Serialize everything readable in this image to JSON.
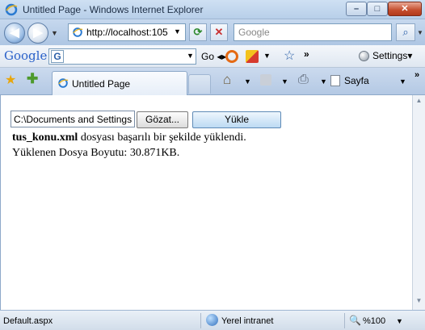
{
  "window": {
    "title": "Untitled Page - Windows Internet Explorer",
    "min_glyph": "–",
    "max_glyph": "□",
    "close_glyph": "✕"
  },
  "nav": {
    "back_glyph": "◀",
    "forward_glyph": "▶",
    "dropdown_glyph": "▼",
    "address": "http://localhost:105",
    "refresh_glyph": "⟳",
    "stop_glyph": "✕",
    "search_placeholder": "Google",
    "search_glyph": "⌕"
  },
  "google_toolbar": {
    "logo": "Google",
    "g_glyph": "G",
    "dropdown_glyph": "▼",
    "go_label": "Go ◂▸",
    "star_glyph": "☆",
    "more_glyph": "»",
    "settings_label": "Settings▾"
  },
  "tabs": {
    "fav_star_glyph": "★",
    "add_fav_glyph": "✚",
    "active_tab_label": "Untitled Page",
    "home_glyph": "⌂",
    "print_glyph": "⎙",
    "page_label": "Sayfa",
    "dropdown_glyph": "▼",
    "more_glyph": "»"
  },
  "content": {
    "file_path": "C:\\Documents and Settings",
    "browse_label": "Gözat...",
    "upload_label": "Yükle",
    "result_filename": "tus_konu.xml",
    "result_message": " dosyası başarılı bir şekilde yüklendi.",
    "size_line": "Yüklenen Dosya Boyutu: 30.871KB."
  },
  "scrollbar": {
    "up_glyph": "▲",
    "down_glyph": "▼"
  },
  "status": {
    "text": "Default.aspx",
    "zone": "Yerel intranet",
    "zoom": "%100",
    "zoom_glyph": "🔍",
    "dropdown_glyph": "▼"
  }
}
